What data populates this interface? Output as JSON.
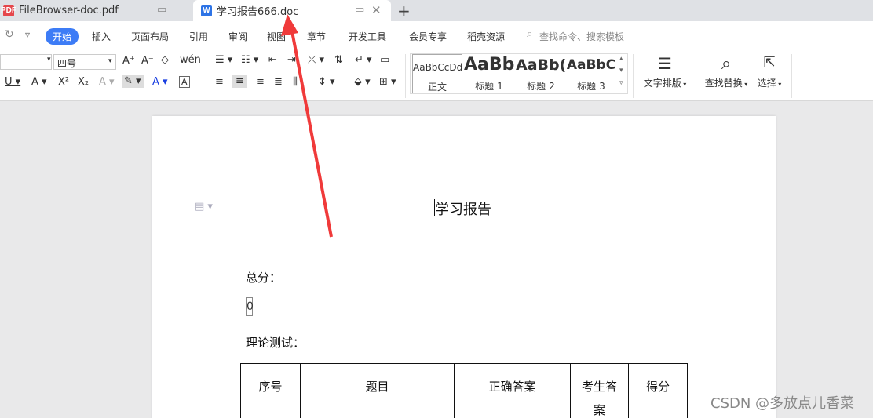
{
  "tabs": [
    {
      "label": "FileBrowser-doc.pdf",
      "type": "PDF"
    },
    {
      "label": "学习报告666.doc",
      "type": "W"
    }
  ],
  "menu": [
    "开始",
    "插入",
    "页面布局",
    "引用",
    "审阅",
    "视图",
    "章节",
    "开发工具",
    "会员专享",
    "稻壳资源"
  ],
  "search_cmd": "查找命令、搜索模板",
  "ribbon": {
    "font_name": "",
    "font_size": "四号",
    "styles": [
      {
        "preview": "AaBbCcDd",
        "label": "正文"
      },
      {
        "preview": "AaBb",
        "label": "标题 1"
      },
      {
        "preview": "AaBb(",
        "label": "标题 2"
      },
      {
        "preview": "AaBbC",
        "label": "标题 3"
      }
    ],
    "text_layout": "文字排版",
    "find_replace": "查找替换",
    "select": "选择"
  },
  "document": {
    "title": "学习报告",
    "total_label": "总分：",
    "total_value": "0",
    "theory_label": "理论测试：",
    "table_headers": [
      "序号",
      "题目",
      "正确答案",
      "考生答案",
      "得分"
    ]
  },
  "watermark": "CSDN @多放点儿香菜",
  "colors": {
    "accent": "#3d7cf6",
    "arrow": "#f03a3a",
    "pdf_icon": "#e5464b",
    "doc_icon": "#2e74e6"
  }
}
